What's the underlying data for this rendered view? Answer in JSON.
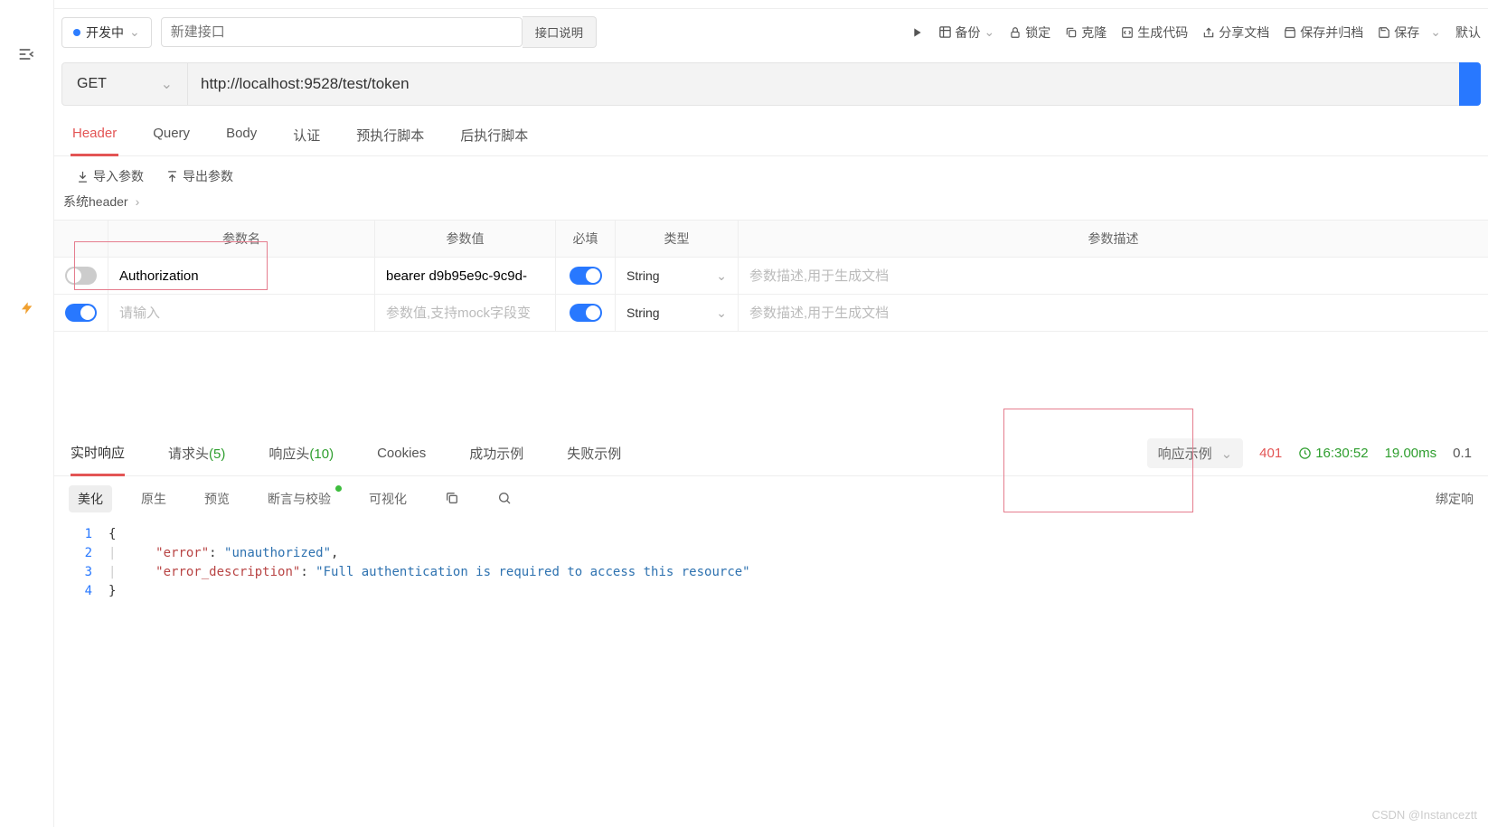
{
  "status": {
    "label": "开发中"
  },
  "apiName": {
    "placeholder": "新建接口"
  },
  "descButton": "接口说明",
  "topActions": {
    "backup": "备份",
    "lock": "锁定",
    "clone": "克隆",
    "gencode": "生成代码",
    "sharedoc": "分享文档",
    "archive": "保存并归档",
    "save": "保存",
    "default": "默认"
  },
  "method": "GET",
  "url": "http://localhost:9528/test/token",
  "reqTabs": [
    "Header",
    "Query",
    "Body",
    "认证",
    "预执行脚本",
    "后执行脚本"
  ],
  "importBtns": {
    "import": "导入参数",
    "export": "导出参数"
  },
  "sysHeader": "系统header",
  "paramHeader": {
    "name": "参数名",
    "value": "参数值",
    "required": "必填",
    "type": "类型",
    "desc": "参数描述"
  },
  "paramPlaceholders": {
    "name": "请输入",
    "value": "参数值,支持mock字段变",
    "desc": "参数描述,用于生成文档"
  },
  "paramRows": [
    {
      "enabled": false,
      "name": "Authorization",
      "value": "bearer d9b95e9c-9c9d-",
      "required": true,
      "type": "String",
      "desc": ""
    },
    {
      "enabled": true,
      "name": "",
      "value": "",
      "required": true,
      "type": "String",
      "desc": ""
    }
  ],
  "respTabs": {
    "realtime": "实时响应",
    "reqHeader": {
      "label": "请求头",
      "count": "(5)"
    },
    "respHeader": {
      "label": "响应头",
      "count": "(10)"
    },
    "cookies": "Cookies",
    "success": "成功示例",
    "fail": "失败示例"
  },
  "respMeta": {
    "example": "响应示例",
    "status": "401",
    "time": "16:30:52",
    "duration": "19.00ms",
    "size": "0.1"
  },
  "respSub": {
    "pretty": "美化",
    "raw": "原生",
    "preview": "预览",
    "assert": "断言与校验",
    "visual": "可视化"
  },
  "bindResp": "绑定响",
  "response": {
    "lines": [
      "1",
      "2",
      "3",
      "4"
    ],
    "errorKey": "\"error\"",
    "errorVal": "\"unauthorized\"",
    "descKey": "\"error_description\"",
    "descVal": "\"Full authentication is required to access this resource\""
  },
  "watermark": "CSDN @Instanceztt"
}
